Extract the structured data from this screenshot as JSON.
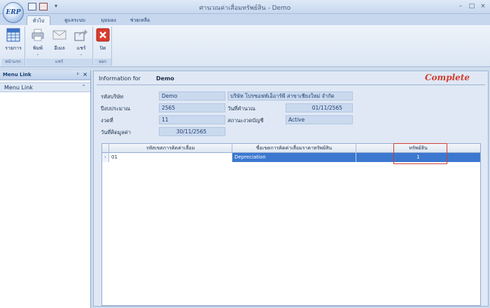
{
  "window": {
    "title": "ศานวณค่าเสื่อมทรัพย์สิน - Demo",
    "logo_text": "ERP",
    "controls": [
      "–",
      "□",
      "×"
    ]
  },
  "ribbon": {
    "tabs": [
      "ทั่วไป",
      "ดูแลระบบ",
      "มุมมอง",
      "ช่วยเหลือ"
    ],
    "active_tab": "ทั่วไป",
    "groups": [
      {
        "label": "หน้าแรก",
        "buttons": [
          {
            "label": "รายการ",
            "icon": "grid-list-icon"
          }
        ]
      },
      {
        "label": "แชร์",
        "buttons": [
          {
            "label": "พิมพ์",
            "icon": "printer-icon"
          },
          {
            "label": "อีเมล",
            "icon": "email-icon"
          },
          {
            "label": "แชร์",
            "icon": "share-icon"
          }
        ]
      },
      {
        "label": "ออก",
        "buttons": [
          {
            "label": "ปิด",
            "icon": "close-red-icon"
          }
        ]
      }
    ]
  },
  "menu_panel": {
    "title": "Menu Link",
    "pin": "ᵖ",
    "close": "×",
    "items": [
      {
        "label": "Menu Link",
        "chevron": "⌃"
      }
    ]
  },
  "header": {
    "info_for_label": "Information for",
    "info_for_value": "Demo",
    "status": "Complete",
    "status_color": "#d43a2c"
  },
  "form": {
    "company_code_label": "รหัสบริษัท",
    "company_code": "Demo",
    "company_name": "บริษัท โปรซอฟท์เอ็อาร์พี สาขาเชียงใหม่ จำกัด",
    "fiscal_year_label": "ปีงบประมาณ",
    "fiscal_year": "2565",
    "calc_date_label": "วันที่คำนวณ",
    "calc_date": "01/11/2565",
    "period_label": "งวดที่",
    "period": "11",
    "period_status_label": "สถานะงวดบัญชี",
    "period_status": "Active",
    "value_date_label": "วันที่คิดมูลค่า",
    "value_date": "30/11/2565"
  },
  "grid": {
    "columns": [
      "รหัสเขตการคิดค่าเสื่อม",
      "ชื่อเขตการคิดค่าเสื่อมราคาทรัพย์สิน",
      "ทรัพย์สิน"
    ],
    "rows": [
      {
        "code": "01",
        "name": "Depreciation",
        "assets": "1",
        "indicator": "›"
      }
    ]
  }
}
